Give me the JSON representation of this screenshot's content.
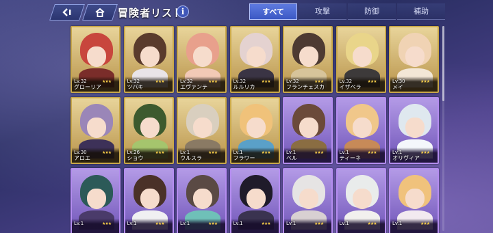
{
  "header": {
    "title": "冒険者リスト",
    "info_label": "i"
  },
  "tabs": [
    {
      "label": "すべて",
      "active": true
    },
    {
      "label": "攻撃",
      "active": false
    },
    {
      "label": "防御",
      "active": false
    },
    {
      "label": "補助",
      "active": false
    }
  ],
  "characters": [
    {
      "name": "グローリア",
      "level": "Lv.32",
      "stars": "★★★",
      "frame": "gold",
      "hair": "#c8463d",
      "outfit": "#7a2d2a"
    },
    {
      "name": "ツバキ",
      "level": "Lv.32",
      "stars": "★★★",
      "frame": "gold",
      "hair": "#5a3b2c",
      "outfit": "#e9e4e8"
    },
    {
      "name": "エヴァンテ",
      "level": "Lv.32",
      "stars": "★★★",
      "frame": "gold",
      "hair": "#e8a08c",
      "outfit": "#f2c9b6"
    },
    {
      "name": "ルルリカ",
      "level": "Lv.32",
      "stars": "★★★",
      "frame": "gold",
      "hair": "#e4d2d0",
      "outfit": "#3a3444"
    },
    {
      "name": "フランチェスカ",
      "level": "Lv.32",
      "stars": "★★★",
      "frame": "gold",
      "hair": "#4d3a32",
      "outfit": "#d7c49a"
    },
    {
      "name": "イザベラ",
      "level": "Lv.32",
      "stars": "★★★",
      "frame": "gold",
      "hair": "#e9d58a",
      "outfit": "#3d3a3a"
    },
    {
      "name": "メイ",
      "level": "Lv.30",
      "stars": "★★★",
      "frame": "gold",
      "hair": "#f0d3b4",
      "outfit": "#f3e7d6"
    },
    {
      "name": "アロエ",
      "level": "Lv.30",
      "stars": "★★★",
      "frame": "gold",
      "hair": "#9a86b8",
      "outfit": "#3d3158"
    },
    {
      "name": "ショウ",
      "level": "Lv.26",
      "stars": "★★★",
      "frame": "gold",
      "hair": "#3d5a2e",
      "outfit": "#a5c56d"
    },
    {
      "name": "ウルスラ",
      "level": "Lv.1",
      "stars": "★★★",
      "frame": "gold",
      "hair": "#d9cfbf",
      "outfit": "#8a7a64"
    },
    {
      "name": "フラワー",
      "level": "Lv.1",
      "stars": "★★★",
      "frame": "gold",
      "hair": "#f0c27a",
      "outfit": "#5aa0c8"
    },
    {
      "name": "ベル",
      "level": "Lv.1",
      "stars": "★★★",
      "frame": "purple",
      "hair": "#6b4a3a",
      "outfit": "#8a6d42"
    },
    {
      "name": "ティーネ",
      "level": "Lv.1",
      "stars": "★★★",
      "frame": "purple",
      "hair": "#f0c78a",
      "outfit": "#c78a58"
    },
    {
      "name": "オリヴィア",
      "level": "Lv.1",
      "stars": "★★★",
      "frame": "purple",
      "hair": "#dfe8ef",
      "outfit": "#f4f7fb"
    },
    {
      "name": "",
      "level": "Lv.1",
      "stars": "★★★",
      "frame": "purple",
      "hair": "#2c5a58",
      "outfit": "#4a3b6a"
    },
    {
      "name": "",
      "level": "Lv.1",
      "stars": "★★★",
      "frame": "purple",
      "hair": "#4a3128",
      "outfit": "#f0f0f2"
    },
    {
      "name": "",
      "level": "Lv.1",
      "stars": "★★★",
      "frame": "purple",
      "hair": "#5a4a44",
      "outfit": "#6fc0b8"
    },
    {
      "name": "",
      "level": "Lv.1",
      "stars": "★★★",
      "frame": "purple",
      "hair": "#1f1b2a",
      "outfit": "#3a3350"
    },
    {
      "name": "",
      "level": "Lv.1",
      "stars": "★★★",
      "frame": "purple",
      "hair": "#e6e4e4",
      "outfit": "#d8d0d2"
    },
    {
      "name": "",
      "level": "Lv.1",
      "stars": "★★★",
      "frame": "purple",
      "hair": "#e9eceb",
      "outfit": "#f2f0ee"
    },
    {
      "name": "",
      "level": "Lv.1",
      "stars": "★★★",
      "frame": "purple",
      "hair": "#f0c27c",
      "outfit": "#f2eaf0"
    }
  ]
}
